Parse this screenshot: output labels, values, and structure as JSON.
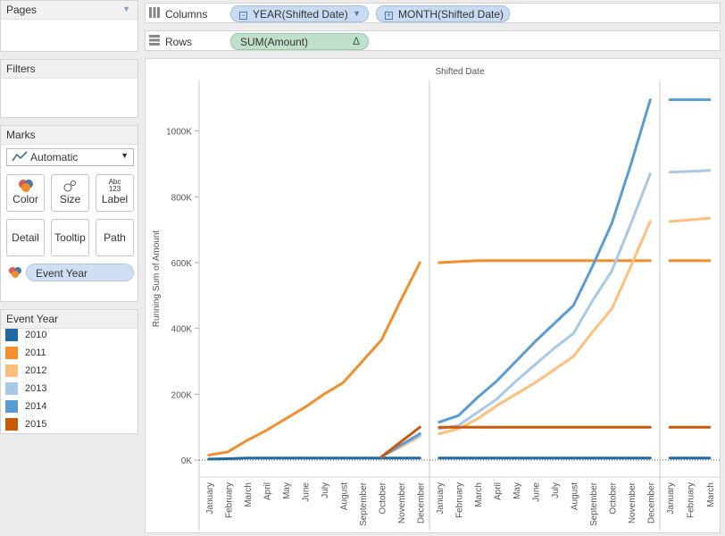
{
  "panels": {
    "pages_title": "Pages",
    "filters_title": "Filters",
    "marks_title": "Marks",
    "mark_type": "Automatic",
    "mark_buttons": {
      "color": "Color",
      "size": "Size",
      "label": "Label",
      "label_glyph": "Abc 123",
      "detail": "Detail",
      "tooltip": "Tooltip",
      "path": "Path"
    },
    "color_pill": "Event Year"
  },
  "legend": {
    "title": "Event Year",
    "items": [
      {
        "label": "2010",
        "color": "#1f6aa5"
      },
      {
        "label": "2011",
        "color": "#f28e2b"
      },
      {
        "label": "2012",
        "color": "#ffbe7d"
      },
      {
        "label": "2013",
        "color": "#a8c8e8"
      },
      {
        "label": "2014",
        "color": "#5a9bd0"
      },
      {
        "label": "2015",
        "color": "#c85a0c"
      }
    ]
  },
  "shelves": {
    "columns_label": "Columns",
    "rows_label": "Rows",
    "columns_pills": [
      "YEAR(Shifted Date)",
      "MONTH(Shifted Date)"
    ],
    "rows_pill": "SUM(Amount)",
    "rows_pill_badge": "Δ"
  },
  "chart_data": {
    "type": "line",
    "title": "Shifted Date",
    "ylabel": "Running Sum of Amount",
    "yticks": [
      "0K",
      "200K",
      "400K",
      "600K",
      "800K",
      "1000K"
    ],
    "ylim": [
      0,
      1150000
    ],
    "grid": false,
    "panes": [
      {
        "categories": [
          "January",
          "February",
          "March",
          "April",
          "May",
          "June",
          "July",
          "August",
          "September",
          "October",
          "November",
          "December"
        ]
      },
      {
        "categories": [
          "January",
          "February",
          "March",
          "April",
          "May",
          "June",
          "July",
          "August",
          "September",
          "October",
          "November",
          "December"
        ]
      },
      {
        "categories": [
          "January",
          "February",
          "March"
        ]
      }
    ],
    "series": [
      {
        "name": "2010",
        "color": "#1f6aa5",
        "panes": [
          [
            3000,
            4000,
            6000,
            6000,
            6000,
            6000,
            6000,
            6000,
            6000,
            6000,
            6000,
            6000
          ],
          [
            6000,
            6000,
            6000,
            6000,
            6000,
            6000,
            6000,
            6000,
            6000,
            6000,
            6000,
            6000
          ],
          [
            6000,
            6000,
            6000
          ]
        ]
      },
      {
        "name": "2011",
        "color": "#f28e2b",
        "panes": [
          [
            15000,
            25000,
            60000,
            90000,
            125000,
            160000,
            200000,
            235000,
            300000,
            365000,
            485000,
            600000
          ],
          [
            600000,
            603000,
            606000,
            606000,
            606000,
            606000,
            606000,
            606000,
            606000,
            606000,
            606000,
            606000
          ],
          [
            606000,
            606000,
            606000
          ]
        ]
      },
      {
        "name": "2012",
        "color": "#ffbe7d",
        "panes": [
          [
            null,
            null,
            null,
            null,
            null,
            null,
            null,
            null,
            null,
            10000,
            40000,
            72000
          ],
          [
            80000,
            95000,
            125000,
            165000,
            200000,
            235000,
            275000,
            315000,
            390000,
            460000,
            590000,
            725000
          ],
          [
            725000,
            730000,
            735000
          ]
        ]
      },
      {
        "name": "2013",
        "color": "#a8c8e8",
        "panes": [
          [
            null,
            null,
            null,
            null,
            null,
            null,
            null,
            null,
            null,
            10000,
            45000,
            75000
          ],
          [
            95000,
            105000,
            145000,
            185000,
            240000,
            290000,
            340000,
            385000,
            485000,
            575000,
            720000,
            870000
          ],
          [
            875000,
            877000,
            880000
          ]
        ]
      },
      {
        "name": "2014",
        "color": "#5a9bd0",
        "panes": [
          [
            null,
            null,
            null,
            null,
            null,
            null,
            null,
            null,
            null,
            10000,
            45000,
            80000
          ],
          [
            115000,
            135000,
            190000,
            240000,
            300000,
            360000,
            415000,
            470000,
            590000,
            720000,
            900000,
            1095000
          ],
          [
            1095000,
            1095000,
            1095000
          ]
        ]
      },
      {
        "name": "2015",
        "color": "#c85a0c",
        "panes": [
          [
            null,
            null,
            null,
            null,
            null,
            null,
            null,
            null,
            null,
            10000,
            55000,
            100000
          ],
          [
            100000,
            100000,
            100000,
            100000,
            100000,
            100000,
            100000,
            100000,
            100000,
            100000,
            100000,
            100000
          ],
          [
            100000,
            100000,
            100000
          ]
        ]
      }
    ]
  }
}
